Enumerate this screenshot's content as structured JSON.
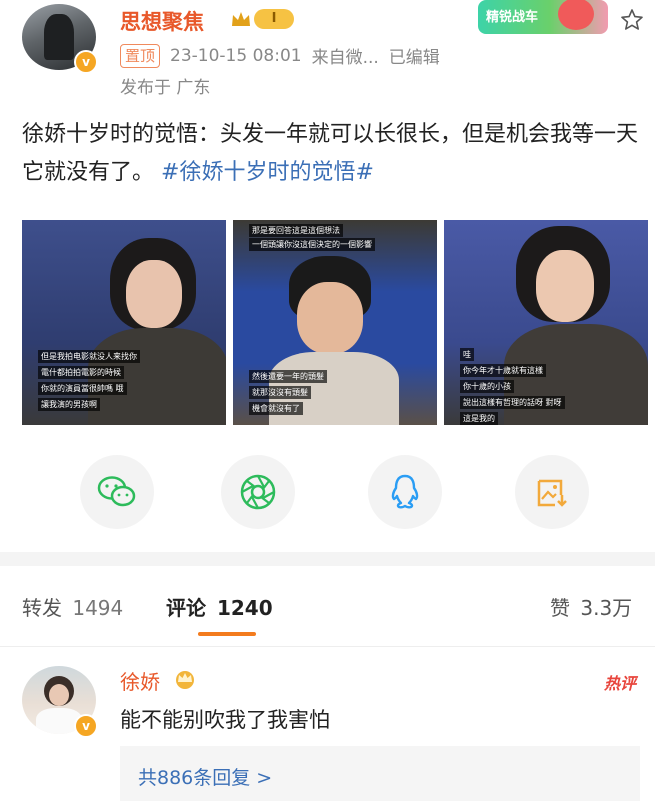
{
  "author": {
    "name": "思想聚焦",
    "level_badge": "I",
    "verified_mark": "v"
  },
  "post_meta": {
    "pinned": "置顶",
    "timestamp": "23-10-15 08:01",
    "source": "来自微...",
    "edited": "已编辑",
    "location": "发布于 广东"
  },
  "top_right_banner": "精锐战车",
  "post_text": {
    "body": "徐娇十岁时的觉悟：头发一年就可以长很长，但是机会我等一天它就没有了。",
    "hashtag": "#徐娇十岁时的觉悟#"
  },
  "images": [
    {
      "captions": [
        "但是我拍电影就没人来找你",
        "電什都拍拍電影的時候",
        "你就的演員當很帥嗎 哦",
        "讓我演的男孩啊"
      ]
    },
    {
      "captions": [
        "那是要回答這是這個想法",
        "一個頭讓你沒這個決定的一個影響",
        "然後還要一年的頭髮",
        "就那沒沒有頭髮",
        "機會就沒有了"
      ]
    },
    {
      "captions": [
        "哇",
        "你今年才十歲就有這樣",
        "你十歲的小孩",
        "說出這樣有哲理的話呀 對呀",
        "這是我的"
      ]
    }
  ],
  "share_icons": [
    "wechat-icon",
    "moments-icon",
    "qq-icon",
    "save-image-icon"
  ],
  "tabs": {
    "repost_label": "转发",
    "repost_count": "1494",
    "comment_label": "评论",
    "comment_count": "1240",
    "like_label": "赞",
    "like_count": "3.3万"
  },
  "comment": {
    "user": "徐娇",
    "hot_badge": "热评",
    "text": "能不能别吹我了我害怕",
    "replies_link": "共886条回复 >"
  },
  "colors": {
    "author_name": "#e8582a",
    "hashtag": "#3b6fb6",
    "tab_underline": "#f37b1d",
    "hot_badge": "#e8453c"
  }
}
